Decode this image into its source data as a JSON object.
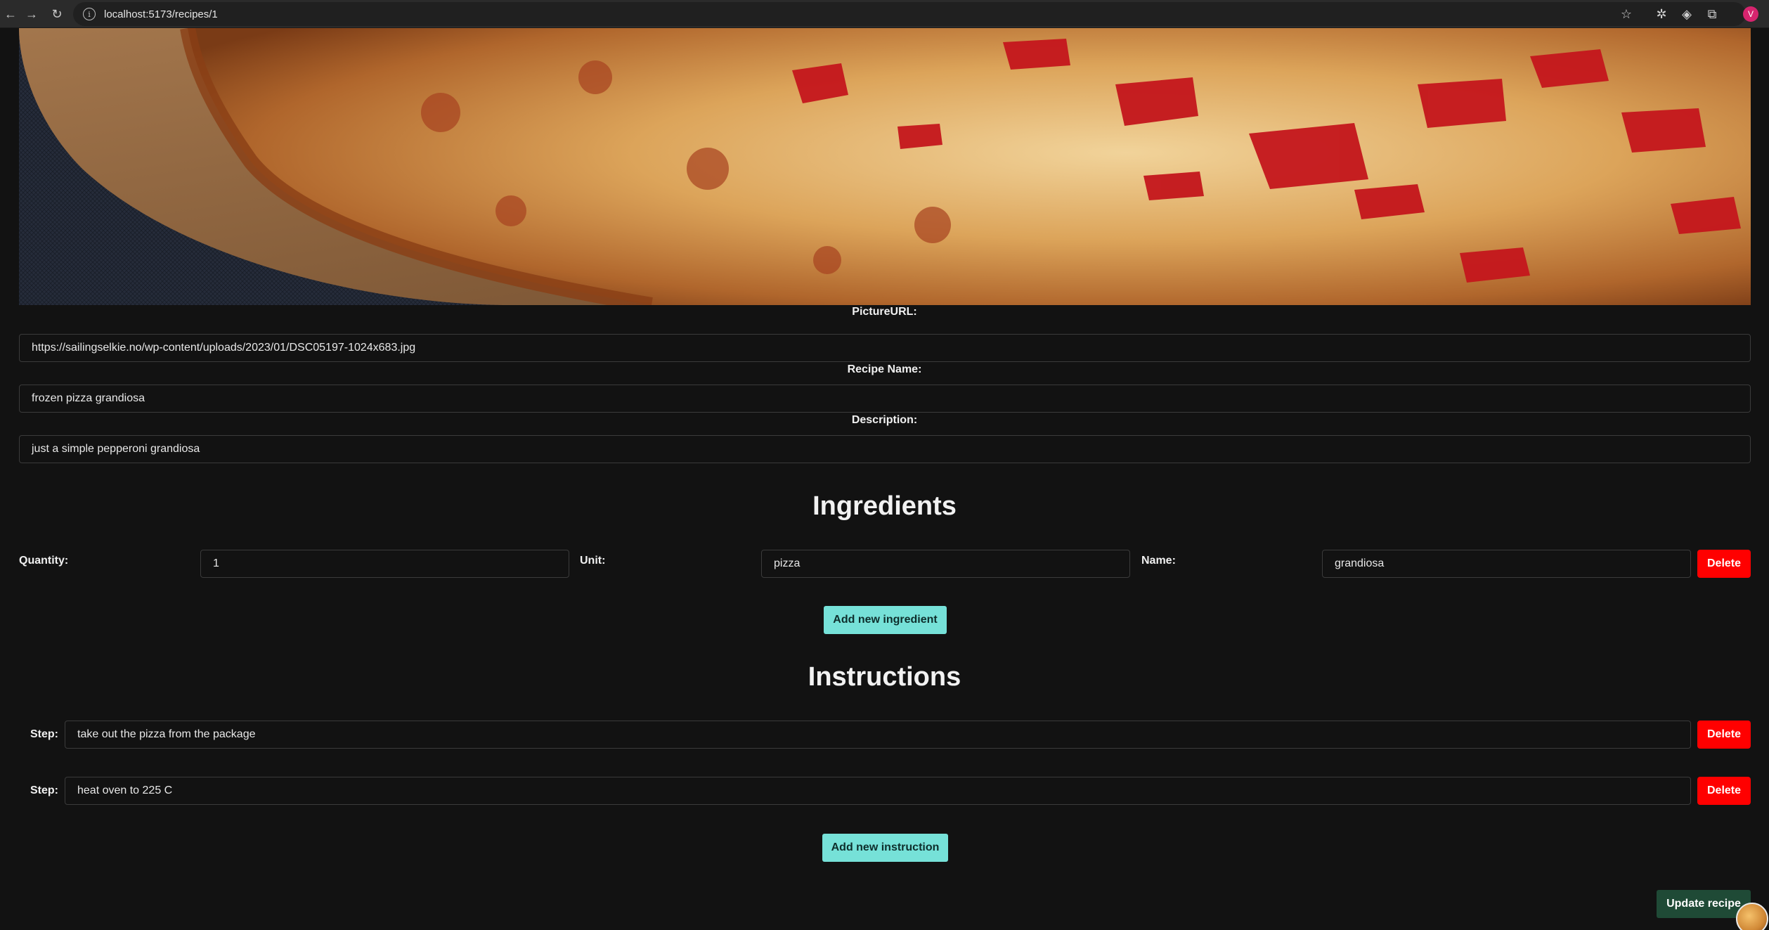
{
  "browser": {
    "url": "localhost:5173/recipes/1"
  },
  "form": {
    "picture_label": "PictureURL:",
    "picture_value": "https://sailingselkie.no/wp-content/uploads/2023/01/DSC05197-1024x683.jpg",
    "name_label": "Recipe Name:",
    "name_value": "frozen pizza grandiosa",
    "description_label": "Description:",
    "description_value": "just a simple pepperoni grandiosa"
  },
  "ingredients": {
    "title": "Ingredients",
    "quantity_label": "Quantity:",
    "unit_label": "Unit:",
    "name_label": "Name:",
    "items": [
      {
        "quantity": "1",
        "unit": "pizza",
        "name": "grandiosa"
      }
    ],
    "delete_label": "Delete",
    "add_label": "Add new ingredient"
  },
  "instructions": {
    "title": "Instructions",
    "step_label": "Step:",
    "steps": [
      {
        "text": "take out the pizza from the package"
      },
      {
        "text": "heat oven to 225 C"
      }
    ],
    "delete_label": "Delete",
    "add_label": "Add new instruction"
  },
  "actions": {
    "update_label": "Update recipe"
  },
  "colors": {
    "background": "#121212",
    "delete": "#ff0000",
    "add": "#76e1d8",
    "update": "#1f4a36"
  }
}
